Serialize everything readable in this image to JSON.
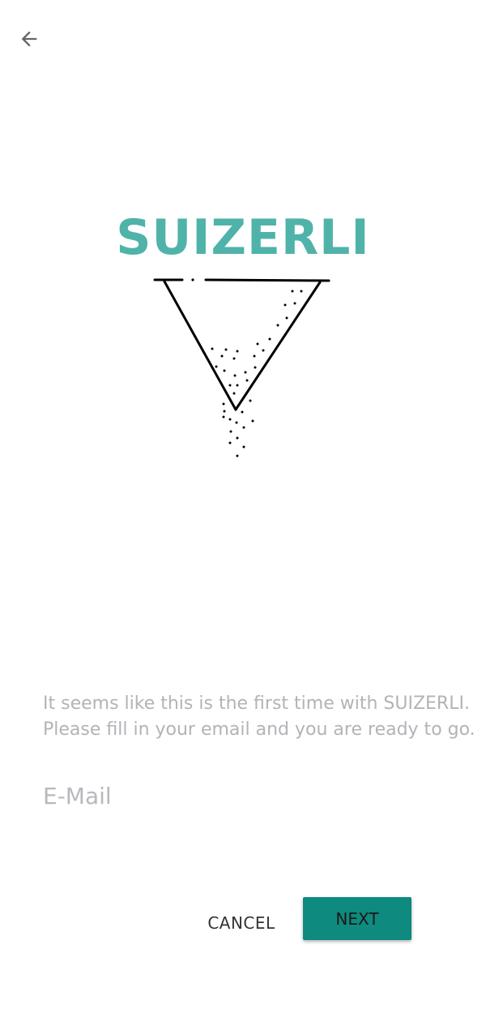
{
  "header": {
    "back_icon": "arrow-left-icon"
  },
  "brand": {
    "title": "SUIZERLI",
    "color": "#4fb3a9"
  },
  "intro": {
    "line1": "It seems like this is the first time with SUIZERLI.",
    "line2": "Please fill in your email and you are ready to go."
  },
  "form": {
    "email_placeholder": "E-Mail",
    "email_value": ""
  },
  "actions": {
    "cancel_label": "CANCEL",
    "next_label": "NEXT",
    "next_color": "#0e8a7f"
  }
}
